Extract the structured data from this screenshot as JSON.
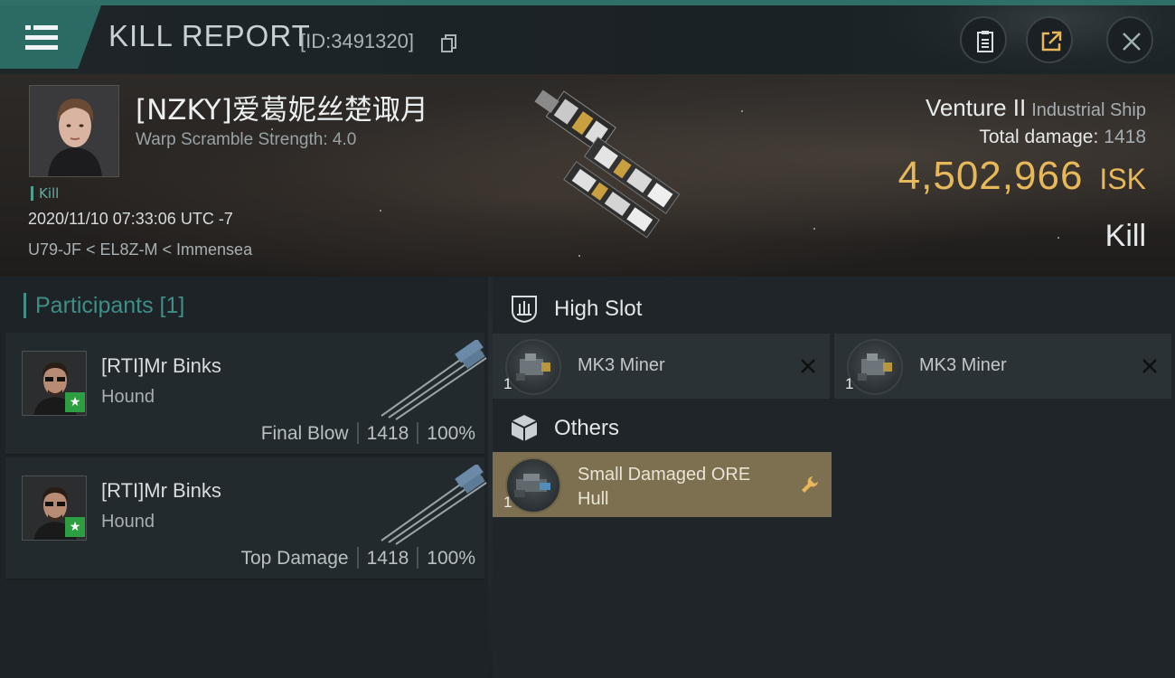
{
  "header": {
    "title": "KILL REPORT",
    "report_id": "[ID:3491320]",
    "icons": [
      "menu-icon",
      "copy-icon",
      "clipboard-icon",
      "share-icon",
      "close-icon"
    ]
  },
  "victim": {
    "name": "[NZKY]爱葛妮丝楚诹月",
    "warp_scramble": "Warp Scramble Strength: 4.0",
    "kill_tag": "Kill",
    "timestamp": "2020/11/10 07:33:06 UTC -7",
    "location": "U79-JF < EL8Z-M < Immensea",
    "ship_name": "Venture II",
    "ship_class": "Industrial Ship",
    "total_damage_label": "Total damage:",
    "total_damage_value": "1418",
    "isk_value": "4,502,966",
    "isk_unit": "ISK",
    "result": "Kill"
  },
  "participants": {
    "heading": "Participants [1]",
    "rows": [
      {
        "name": "[RTI]Mr Binks",
        "ship": "Hound",
        "role": "Final Blow",
        "damage": "1418",
        "percent": "100%"
      },
      {
        "name": "[RTI]Mr Binks",
        "ship": "Hound",
        "role": "Top Damage",
        "damage": "1418",
        "percent": "100%"
      }
    ]
  },
  "fitting": {
    "high_slot_label": "High Slot",
    "others_label": "Others",
    "high_slot_modules": [
      {
        "qty": "1",
        "name": "MK3 Miner",
        "status": "destroyed"
      },
      {
        "qty": "1",
        "name": "MK3 Miner",
        "status": "destroyed"
      }
    ],
    "others_modules": [
      {
        "qty": "1",
        "name": "Small Damaged ORE Hull",
        "status": "dropped"
      }
    ]
  },
  "colors": {
    "accent_teal": "#2c6b63",
    "isk_gold": "#e7b85a",
    "dropped_gold": "#7d7050",
    "ally_green": "#2e9e43"
  }
}
